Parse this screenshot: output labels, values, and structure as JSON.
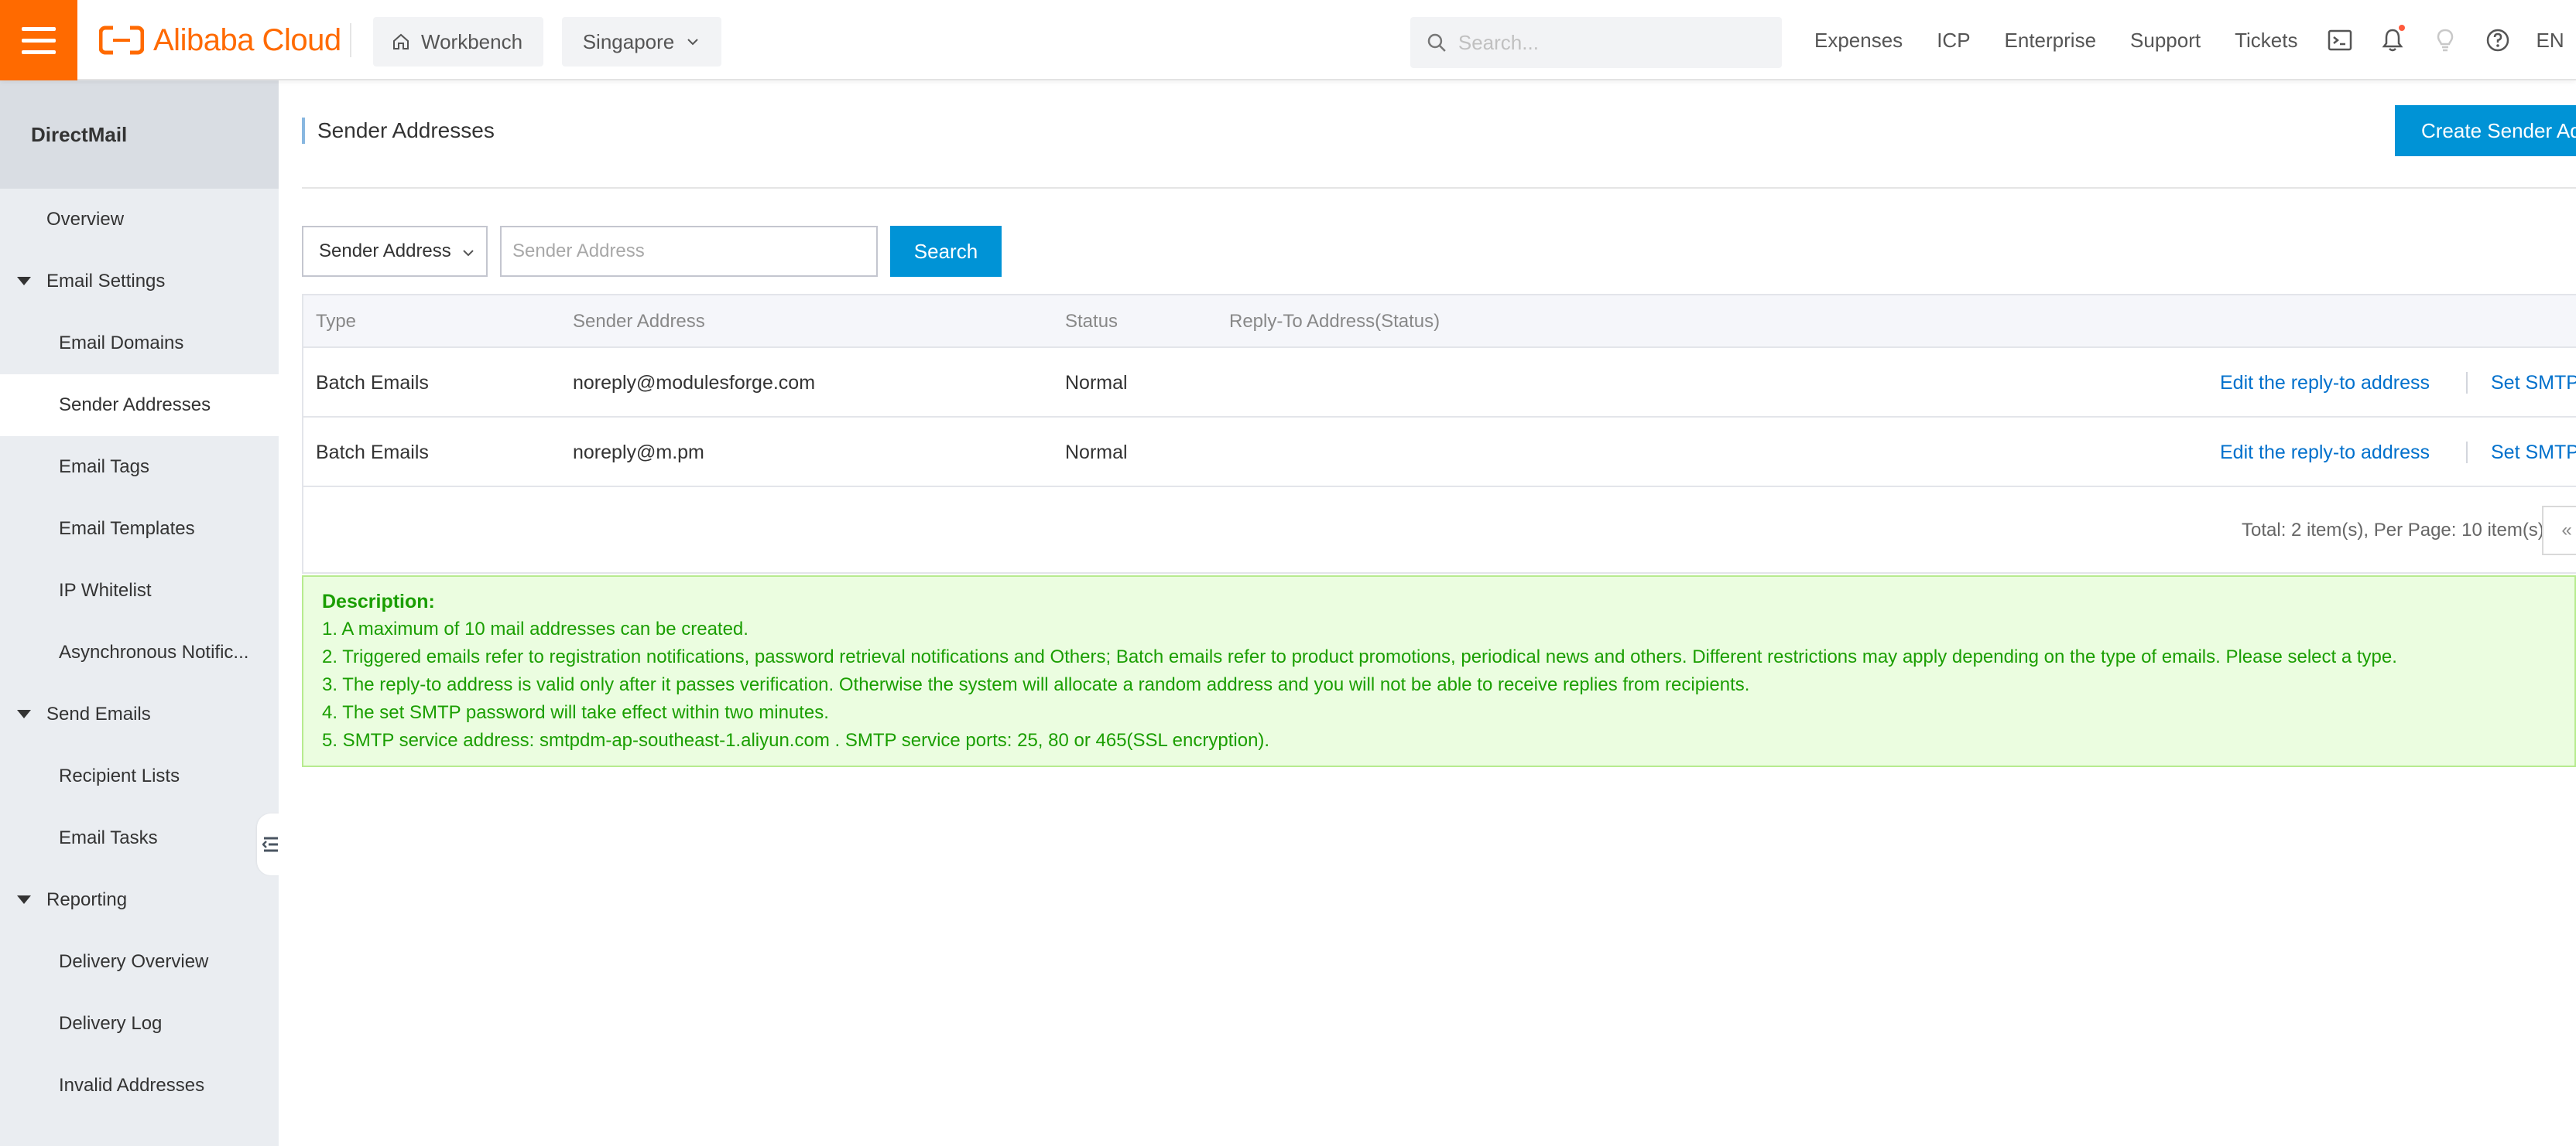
{
  "topbar": {
    "brand": "Alibaba Cloud",
    "workbench_label": "Workbench",
    "region_label": "Singapore",
    "search_placeholder": "Search...",
    "links": [
      "Expenses",
      "ICP",
      "Enterprise",
      "Support",
      "Tickets"
    ],
    "language": "EN",
    "icons": [
      "terminal-icon",
      "bell-icon",
      "bulb-icon",
      "help-icon"
    ]
  },
  "sidebar": {
    "product": "DirectMail",
    "items": [
      {
        "label": "Overview",
        "level": 1
      },
      {
        "label": "Email Settings",
        "level": 0
      },
      {
        "label": "Email Domains",
        "level": 2
      },
      {
        "label": "Sender Addresses",
        "level": 2,
        "active": true
      },
      {
        "label": "Email Tags",
        "level": 2
      },
      {
        "label": "Email Templates",
        "level": 2
      },
      {
        "label": "IP Whitelist",
        "level": 2
      },
      {
        "label": "Asynchronous Notific...",
        "level": 2
      },
      {
        "label": "Send Emails",
        "level": 0
      },
      {
        "label": "Recipient Lists",
        "level": 2
      },
      {
        "label": "Email Tasks",
        "level": 2
      },
      {
        "label": "Reporting",
        "level": 0
      },
      {
        "label": "Delivery Overview",
        "level": 2
      },
      {
        "label": "Delivery Log",
        "level": 2
      },
      {
        "label": "Invalid Addresses",
        "level": 2
      }
    ]
  },
  "page": {
    "title": "Sender Addresses",
    "create_button": "Create Sender Address"
  },
  "filter": {
    "select_value": "Sender Address",
    "input_placeholder": "Sender Address",
    "search_button": "Search"
  },
  "table": {
    "columns": [
      "Type",
      "Sender Address",
      "Status",
      "Reply-To Address(Status)"
    ],
    "rows": [
      {
        "type": "Batch Emails",
        "address": "noreply@modulesforge.com",
        "status": "Normal",
        "reply_to": "",
        "action1": "Edit the reply-to address",
        "action2": "Set SMTP password"
      },
      {
        "type": "Batch Emails",
        "address": "noreply@m.pm",
        "status": "Normal",
        "reply_to": "",
        "action1": "Edit the reply-to address",
        "action2": "Set SMTP password"
      }
    ]
  },
  "pagination": {
    "total_text": "Total: 2 item(s), Per Page: 10 item(s)",
    "prev": "«"
  },
  "description": {
    "title": "Description:",
    "lines": [
      "1. A maximum of 10 mail addresses can be created.",
      "2. Triggered emails refer to registration notifications, password retrieval notifications and Others; Batch emails refer to product promotions, periodical news and others. Different restrictions may apply depending on the type of emails. Please select a type.",
      "3. The reply-to address is valid only after it passes verification. Otherwise the system will allocate a random address and you will not be able to receive replies from recipients.",
      "4. The set SMTP password will take effect within two minutes.",
      "5. SMTP service address: smtpdm-ap-southeast-1.aliyun.com . SMTP service ports: 25, 80 or 465(SSL encryption)."
    ]
  },
  "colors": {
    "brand_orange": "#ff6a00",
    "primary_blue": "#0093d6",
    "link_blue": "#0070cc",
    "success_green": "#1a9e00"
  }
}
